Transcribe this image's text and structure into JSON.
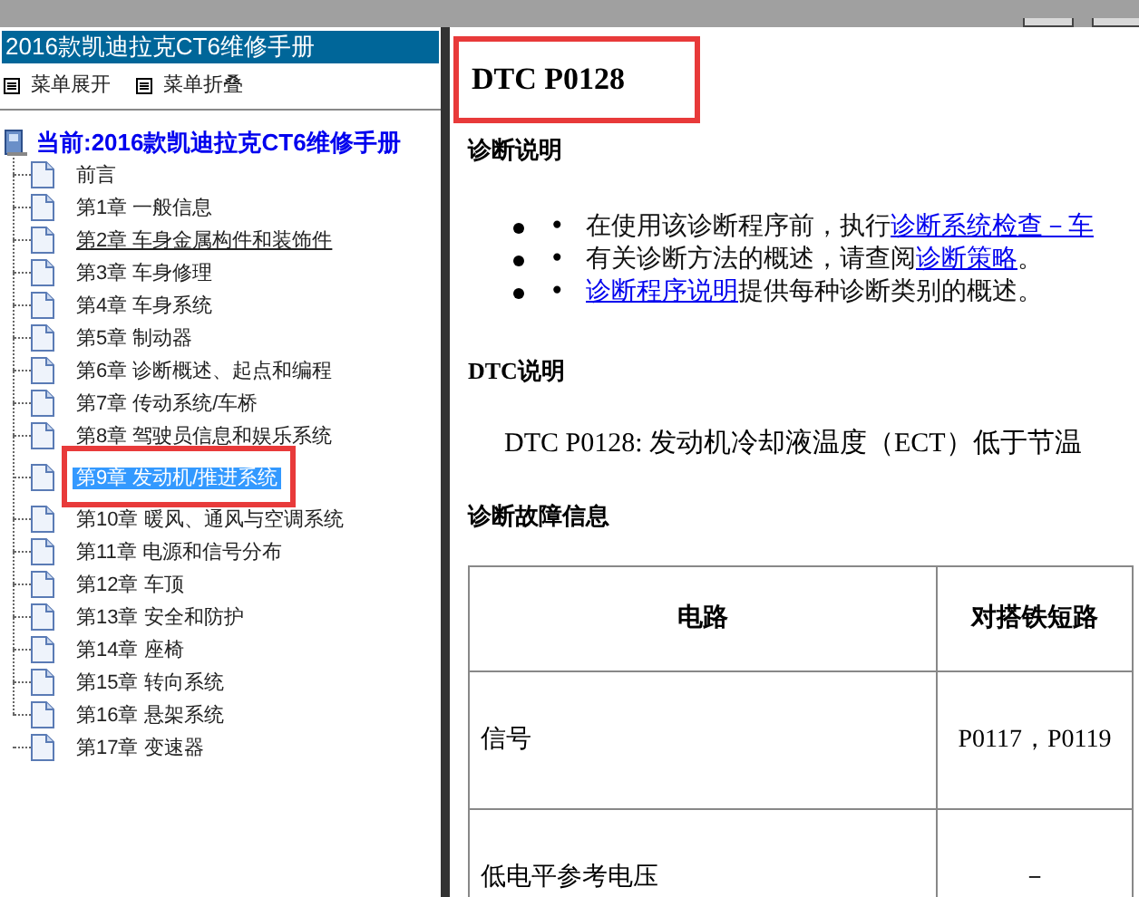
{
  "sidebar": {
    "title": "2016款凯迪拉克CT6维修手册",
    "menu_buttons": [
      "菜单展开",
      "菜单折叠"
    ],
    "tree": {
      "label": "当前:2016款凯迪拉克CT6维修手册",
      "children": [
        {
          "label": "前言",
          "selected": false,
          "hovered": false,
          "annotated": false
        },
        {
          "label": "第1章 一般信息",
          "selected": false,
          "hovered": false,
          "annotated": false
        },
        {
          "label": "第2章 车身金属构件和装饰件",
          "selected": false,
          "hovered": true,
          "annotated": false
        },
        {
          "label": "第3章 车身修理",
          "selected": false,
          "hovered": false,
          "annotated": false
        },
        {
          "label": "第4章 车身系统",
          "selected": false,
          "hovered": false,
          "annotated": false
        },
        {
          "label": "第5章 制动器",
          "selected": false,
          "hovered": false,
          "annotated": false
        },
        {
          "label": "第6章 诊断概述、起点和编程",
          "selected": false,
          "hovered": false,
          "annotated": false
        },
        {
          "label": "第7章 传动系统/车桥",
          "selected": false,
          "hovered": false,
          "annotated": false
        },
        {
          "label": "第8章 驾驶员信息和娱乐系统",
          "selected": false,
          "hovered": false,
          "annotated": false
        },
        {
          "label": "第9章 发动机/推进系统",
          "selected": true,
          "hovered": false,
          "annotated": true
        },
        {
          "label": "第10章 暖风、通风与空调系统",
          "selected": false,
          "hovered": false,
          "annotated": false
        },
        {
          "label": "第11章 电源和信号分布",
          "selected": false,
          "hovered": false,
          "annotated": false
        },
        {
          "label": "第12章 车顶",
          "selected": false,
          "hovered": false,
          "annotated": false
        },
        {
          "label": "第13章 安全和防护",
          "selected": false,
          "hovered": false,
          "annotated": false
        },
        {
          "label": "第14章 座椅",
          "selected": false,
          "hovered": false,
          "annotated": false
        },
        {
          "label": "第15章 转向系统",
          "selected": false,
          "hovered": false,
          "annotated": false
        },
        {
          "label": "第16章 悬架系统",
          "selected": false,
          "hovered": false,
          "annotated": false
        },
        {
          "label": "第17章 变速器",
          "selected": false,
          "hovered": false,
          "annotated": false
        }
      ]
    }
  },
  "content": {
    "title": "DTC P0128",
    "title_annotated": true,
    "diagnosis_heading": "诊断说明",
    "bullets": [
      {
        "marker": "•",
        "segments": [
          {
            "text": "在使用该诊断程序前，执行",
            "link": false
          },
          {
            "text": "诊断系统检查－车",
            "link": true
          }
        ]
      },
      {
        "marker": "•",
        "segments": [
          {
            "text": "有关诊断方法的概述，请查阅",
            "link": false
          },
          {
            "text": "诊断策略",
            "link": true
          },
          {
            "text": "。",
            "link": false
          }
        ]
      },
      {
        "marker": "•",
        "segments": [
          {
            "text": "诊断程序说明",
            "link": true
          },
          {
            "text": "提供每种诊断类别的概述。",
            "link": false
          }
        ]
      }
    ],
    "dtc_heading": "DTC说明",
    "dtc_text": "DTC P0128: 发动机冷却液温度（ECT）低于节温",
    "fault_heading": "诊断故障信息",
    "table": {
      "columns": [
        "电路",
        "对搭铁短路"
      ],
      "rows": [
        [
          "信号",
          "P0117，P0119"
        ],
        [
          "低电平参考电压",
          "－"
        ]
      ]
    }
  }
}
